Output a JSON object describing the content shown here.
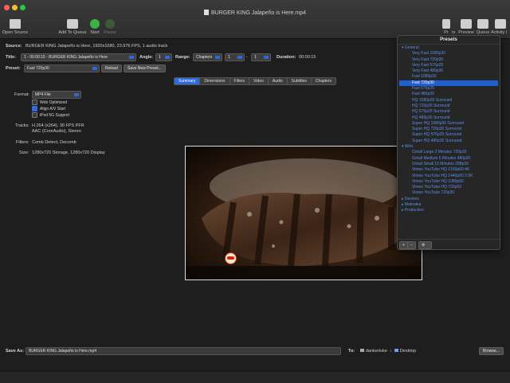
{
  "window": {
    "title": "BURGER KING  Jalapeño is Here.mp4"
  },
  "toolbar": {
    "open_source": "Open Source",
    "add_to_queue": "Add To Queue",
    "start": "Start",
    "pause": "Pause",
    "presets_short": "Pr",
    "presets_short2": "rs",
    "preview": "Preview",
    "queue": "Queue",
    "activity": "Activity I"
  },
  "source": {
    "label": "Source:",
    "value": "BURGER KING  Jalapeño is Here, 1920x1080, 23.976 FPS, 1 audio track"
  },
  "title_row": {
    "title_label": "Title:",
    "title_value": "1 - 00:00:15 - BURGER KING  Jalapeño is Here",
    "angle_label": "Angle:",
    "angle_value": "1",
    "range_label": "Range:",
    "range_value": "Chapters",
    "range_from": "1",
    "range_dash": "-",
    "range_to": "1",
    "duration_label": "Duration:",
    "duration_value": "00:00:15"
  },
  "preset_row": {
    "label": "Preset:",
    "value": "Fast 720p30",
    "reload": "Reload",
    "save_new": "Save New Preset..."
  },
  "tabs": [
    "Summary",
    "Dimensions",
    "Filters",
    "Video",
    "Audio",
    "Subtitles",
    "Chapters"
  ],
  "summary": {
    "format_label": "Format:",
    "format_value": "MP4 File",
    "web_optimized": "Web Optimized",
    "align_av": "Align A/V Start",
    "ipod": "iPod 5G Support",
    "tracks_label": "Tracks:",
    "tracks_line1": "H.264 (x264), 30 FPS PFR",
    "tracks_line2": "AAC (CoreAudio), Stereo",
    "filters_label": "Filters:",
    "filters_value": "Comb Detect, Decomb",
    "size_label": "Size:",
    "size_value": "1280x720 Storage, 1280x720 Display"
  },
  "presets_panel": {
    "title": "Presets",
    "groups": [
      {
        "name": "General",
        "items": [
          "Very Fast 1080p30",
          "Very Fast 720p30",
          "Very Fast 576p25",
          "Very Fast 480p30",
          "Fast 1080p30",
          "Fast 720p30",
          "Fast 576p25",
          "Fast 480p30",
          "HQ 1080p30 Surround",
          "HQ 720p30 Surround",
          "HQ 576p25 Surround",
          "HQ 480p30 Surround",
          "Super HQ 1080p30 Surround",
          "Super HQ 720p30 Surround",
          "Super HQ 576p25 Surround",
          "Super HQ 480p30 Surround"
        ]
      },
      {
        "name": "Web",
        "items": [
          "Gmail Large 3 Minutes 720p30",
          "Gmail Medium 5 Minutes 480p30",
          "Gmail Small 10 Minutes 288p30",
          "Vimeo YouTube HQ 2160p60 4K",
          "Vimeo YouTube HQ 1440p60 2.5K",
          "Vimeo YouTube HQ 1080p60",
          "Vimeo YouTube HQ 720p60",
          "Vimeo YouTube 720p30"
        ]
      },
      {
        "name": "Devices",
        "items": []
      },
      {
        "name": "Matroska",
        "items": []
      },
      {
        "name": "Production",
        "items": []
      }
    ],
    "selected": "Fast 720p30",
    "add": "+",
    "remove": "−"
  },
  "save": {
    "label": "Save As:",
    "value": "BURGER KING  Jalapeño is Here.mp4",
    "to_label": "To:",
    "path_user": "dankerluke",
    "path_sep": "›",
    "path_folder": "Desktop",
    "browse": "Browse..."
  },
  "colors": {
    "accent": "#2f6ad9",
    "link": "#5a8fe8",
    "background": "#1e1e1e"
  }
}
